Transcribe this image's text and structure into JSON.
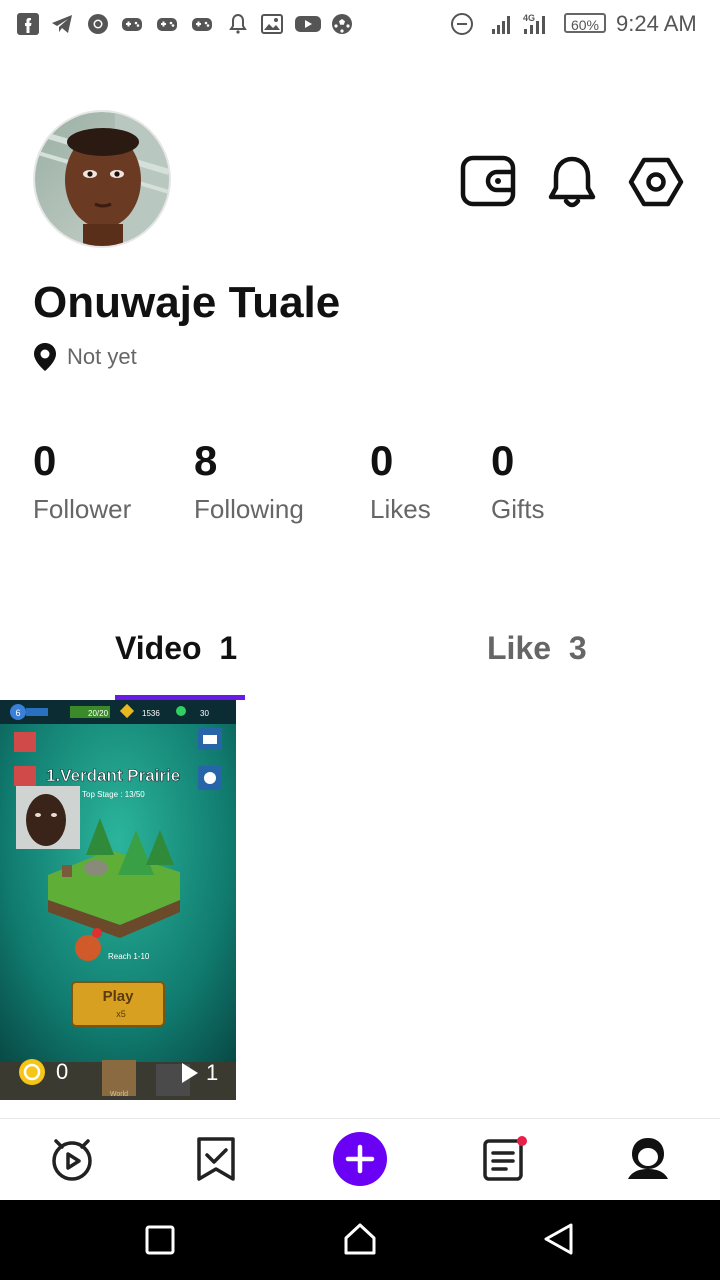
{
  "status_bar": {
    "time": "9:24 AM",
    "battery": "60%",
    "network": "4G"
  },
  "profile": {
    "name": "Onuwaje Tuale",
    "location": "Not yet"
  },
  "stats": [
    {
      "value": "0",
      "label": "Follower"
    },
    {
      "value": "8",
      "label": "Following"
    },
    {
      "value": "0",
      "label": "Likes"
    },
    {
      "value": "0",
      "label": "Gifts"
    }
  ],
  "tabs": [
    {
      "label": "Video",
      "count": "1",
      "active": true
    },
    {
      "label": "Like",
      "count": "3",
      "active": false
    }
  ],
  "video_card": {
    "game_title": "1.Verdant Prairie",
    "top_stage": "Top Stage : 13/50",
    "level": "6",
    "energy": "20/20",
    "coins": "1536",
    "gems": "30",
    "reach_text": "Reach 1-10",
    "play_label": "Play",
    "play_cost": "x5",
    "world_label": "World",
    "likes_count": "0",
    "plays_count": "1"
  },
  "colors": {
    "accent": "#6a1ae6",
    "plus_button": "#6a00f4"
  },
  "icons": {
    "header": [
      "wallet-icon",
      "bell-icon",
      "settings-icon"
    ],
    "nav": [
      "home-icon",
      "bookmark-icon",
      "plus-icon",
      "notes-icon",
      "profile-icon"
    ]
  }
}
